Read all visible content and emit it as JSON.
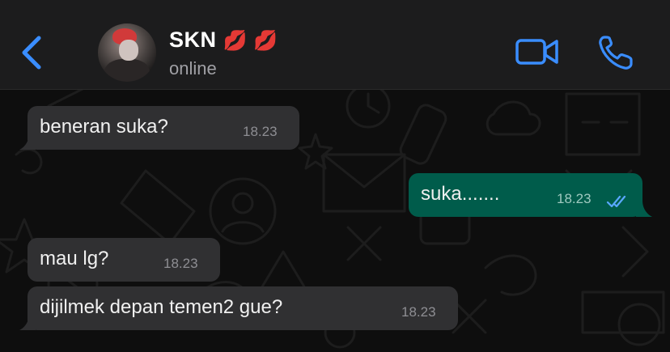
{
  "header": {
    "contact_name": "SKN",
    "contact_emoji": "💋 💋",
    "status": "online",
    "icons": [
      "back-chevron-icon",
      "video-call-icon",
      "phone-icon"
    ],
    "accent_color": "#3a8dff"
  },
  "messages": [
    {
      "direction": "incoming",
      "text": "beneran suka?",
      "time": "18.23"
    },
    {
      "direction": "outgoing",
      "text": "suka.......",
      "time": "18.23",
      "read_receipt": "double-check-icon"
    },
    {
      "direction": "incoming",
      "text": "mau lg?",
      "time": "18.23"
    },
    {
      "direction": "incoming",
      "text": "dijilmek depan temen2 gue?",
      "time": "18.23"
    }
  ]
}
